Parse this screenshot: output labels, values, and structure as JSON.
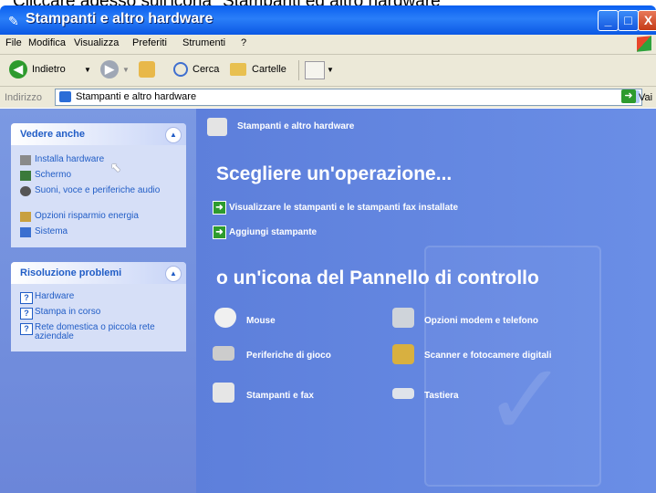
{
  "caption": "Cliccare adesso sull'icona \"Stampanti ed altro hardware\"",
  "window": {
    "title": "Stampanti e altro hardware",
    "controls": {
      "minimize": "_",
      "maximize": "□",
      "close": "X"
    }
  },
  "menu": [
    "File",
    "Modifica",
    "Visualizza",
    "Preferiti",
    "Strumenti",
    "?"
  ],
  "toolbar": {
    "back": "Indietro",
    "search": "Cerca",
    "folders": "Cartelle"
  },
  "address": {
    "label": "Indirizzo",
    "value": "Stampanti e altro hardware",
    "go": "Vai"
  },
  "see_also": {
    "title": "Vedere anche",
    "items": [
      {
        "label": "Installa hardware",
        "icon": "install-hardware-icon"
      },
      {
        "label": "Schermo",
        "icon": "display-icon"
      },
      {
        "label": "Suoni, voce e periferiche audio",
        "icon": "sound-icon"
      },
      {
        "label": "Opzioni risparmio energia",
        "icon": "power-icon"
      },
      {
        "label": "Sistema",
        "icon": "system-icon"
      }
    ]
  },
  "troubleshoot": {
    "title": "Risoluzione problemi",
    "items": [
      {
        "label": "Hardware",
        "icon": "help-icon"
      },
      {
        "label": "Stampa in corso",
        "icon": "help-icon"
      },
      {
        "label": "Rete domestica o piccola rete aziendale",
        "icon": "help-icon"
      }
    ]
  },
  "main": {
    "header": "Stampanti e altro hardware",
    "choose_task": "Scegliere un'operazione...",
    "tasks": [
      "Visualizzare le stampanti e le stampanti fax installate",
      "Aggiungi stampante"
    ],
    "or_pick_icon": "o un'icona del Pannello di controllo",
    "icons": [
      {
        "label": "Mouse",
        "icon": "mouse-icon"
      },
      {
        "label": "Opzioni modem e telefono",
        "icon": "phone-modem-icon"
      },
      {
        "label": "Periferiche di gioco",
        "icon": "game-controller-icon"
      },
      {
        "label": "Scanner e fotocamere digitali",
        "icon": "scanner-camera-icon"
      },
      {
        "label": "Stampanti e fax",
        "icon": "printer-fax-icon"
      },
      {
        "label": "Tastiera",
        "icon": "keyboard-icon"
      }
    ]
  },
  "colors": {
    "titlebar": "#0a5ff0",
    "pane_link": "#215dc6",
    "content_bg": "#6a8ee6"
  }
}
